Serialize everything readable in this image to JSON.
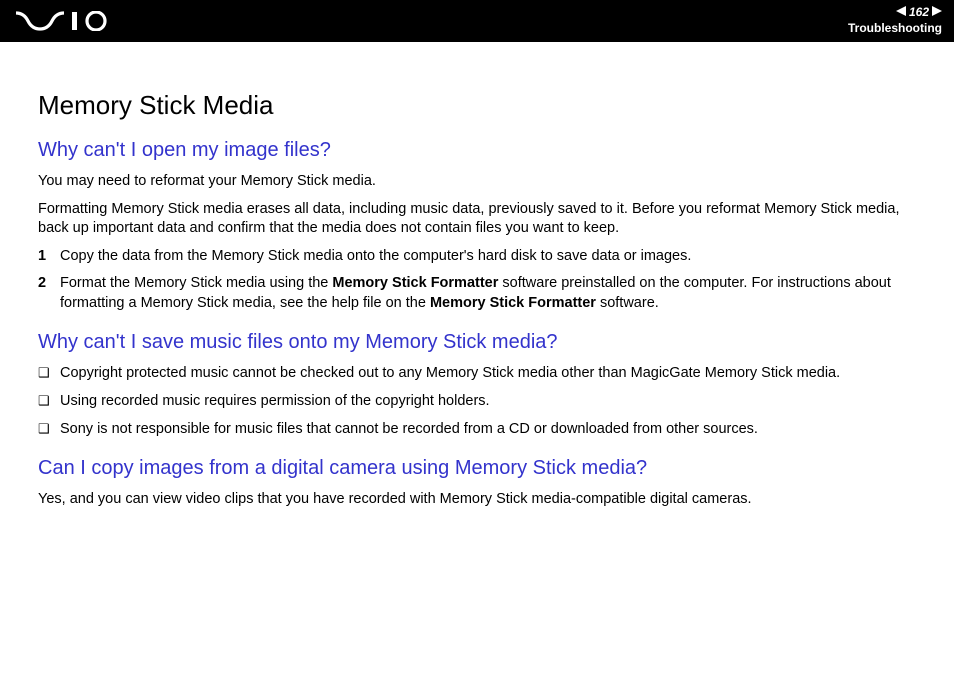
{
  "header": {
    "page_number": "162",
    "section_label": "Troubleshooting"
  },
  "content": {
    "title": "Memory Stick Media",
    "q1": {
      "heading": "Why can't I open my image files?",
      "p1": "You may need to reformat your Memory Stick media.",
      "p2": "Formatting Memory Stick media erases all data, including music data, previously saved to it. Before you reformat Memory Stick media, back up important data and confirm that the media does not contain files you want to keep.",
      "step1_num": "1",
      "step1": "Copy the data from the Memory Stick media onto the computer's hard disk to save data or images.",
      "step2_num": "2",
      "step2_a": "Format the Memory Stick media using the ",
      "step2_b": "Memory Stick Formatter",
      "step2_c": " software preinstalled on the computer. For instructions about formatting a Memory Stick media, see the help file on the ",
      "step2_d": "Memory Stick Formatter",
      "step2_e": " software."
    },
    "q2": {
      "heading": "Why can't I save music files onto my Memory Stick media?",
      "b1": "Copyright protected music cannot be checked out to any Memory Stick media other than MagicGate Memory Stick media.",
      "b2": "Using recorded music requires permission of the copyright holders.",
      "b3": "Sony is not responsible for music files that cannot be recorded from a CD or downloaded from other sources."
    },
    "q3": {
      "heading": "Can I copy images from a digital camera using Memory Stick media?",
      "p1": "Yes, and you can view video clips that you have recorded with Memory Stick media-compatible digital cameras."
    }
  }
}
